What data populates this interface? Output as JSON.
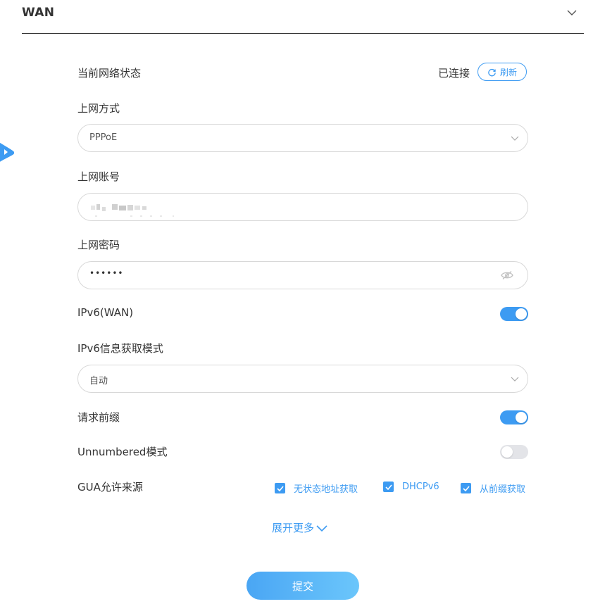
{
  "section": {
    "title": "WAN"
  },
  "network_status": {
    "label": "当前网络状态",
    "value": "已连接",
    "refresh_label": "刷新"
  },
  "connection_type": {
    "label": "上网方式",
    "value": "PPPoE"
  },
  "account": {
    "label": "上网账号",
    "value_obscured": true
  },
  "password": {
    "label": "上网密码",
    "value_masked": "••••••"
  },
  "ipv6_wan": {
    "label": "IPv6(WAN)",
    "enabled": true
  },
  "ipv6_mode": {
    "label": "IPv6信息获取模式",
    "value": "自动"
  },
  "request_prefix": {
    "label": "请求前缀",
    "enabled": true
  },
  "unnumbered_mode": {
    "label": "Unnumbered模式",
    "enabled": false
  },
  "gua_sources": {
    "label": "GUA允许来源",
    "options": [
      {
        "label": "无状态地址获取",
        "checked": true
      },
      {
        "label": "DHCPv6",
        "checked": true
      },
      {
        "label": "从前缀获取",
        "checked": true
      }
    ]
  },
  "expand_more_label": "展开更多",
  "submit_label": "提交",
  "colors": {
    "accent": "#3d9bf2",
    "toggle_off": "#e3e4e8",
    "border": "#d8d8d8",
    "text": "#333333"
  }
}
